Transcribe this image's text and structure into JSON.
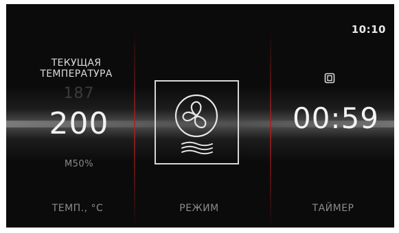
{
  "status_bar": {
    "time": "10:10"
  },
  "temperature_panel": {
    "label_line1": "ТЕКУЩАЯ",
    "label_line2": "ТЕМПЕРАТУРА",
    "current_value": "187",
    "set_value": "200",
    "mode_code": "M50%",
    "button_label": "ТЕМП., °C"
  },
  "mode_panel": {
    "icon": "fan-convection-icon",
    "button_label": "РЕЖИМ"
  },
  "timer_panel": {
    "icon": "lock-icon",
    "value": "00:59",
    "button_label": "ТАЙМЕР"
  },
  "colors": {
    "background": "#0b0b0c",
    "divider": "#b41e1e",
    "text_primary": "#f2f2f2",
    "text_secondary": "#8c8c8c"
  }
}
